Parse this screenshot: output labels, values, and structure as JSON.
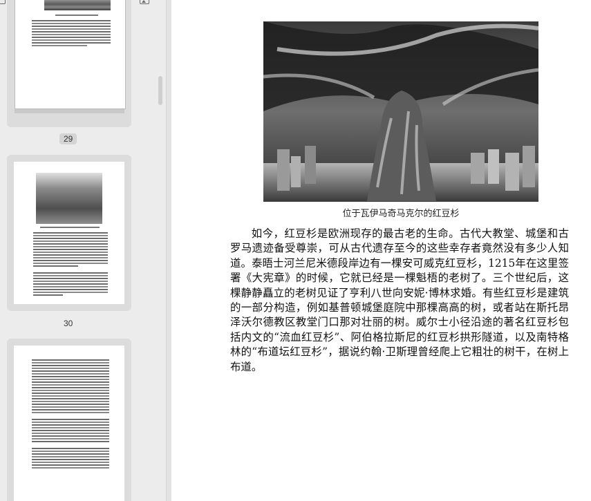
{
  "sidebar": {
    "zoom": {
      "small_icon": "image-small-icon",
      "large_icon": "image-large-icon",
      "level": 0.18
    },
    "thumbnails": [
      {
        "label": "29",
        "active": true
      },
      {
        "label": "30",
        "active": false
      },
      {
        "label": "",
        "active": false
      }
    ]
  },
  "page": {
    "figure_caption": "位于瓦伊马奇马克尔的红豆杉",
    "paragraph": "如今，红豆杉是欧洲现存的最古老的生命。古代大教堂、城堡和古罗马遗迹备受尊崇，可从古代遗存至今的这些幸存者竟然没有多少人知道。泰晤士河兰尼米德段岸边有一棵安可威克红豆杉，1215年在这里签署《大宪章》的时候，它就已经是一棵魁梧的老树了。三个世纪后，这棵静静矗立的老树见证了亨利八世向安妮·博林求婚。有些红豆杉是建筑的一部分构造，例如基普顿城堡庭院中那棵高高的树，或者站在斯托昂泽沃尔德教区教堂门口那对壮丽的树。威尔士小径沿途的著名红豆杉包括内文的“流血红豆杉”、阿伯格拉斯尼的红豆杉拱形隧道，以及南特格林的“布道坛红豆杉”，据说约翰·卫斯理曾经爬上它粗壮的树干，在树上布道。"
  }
}
